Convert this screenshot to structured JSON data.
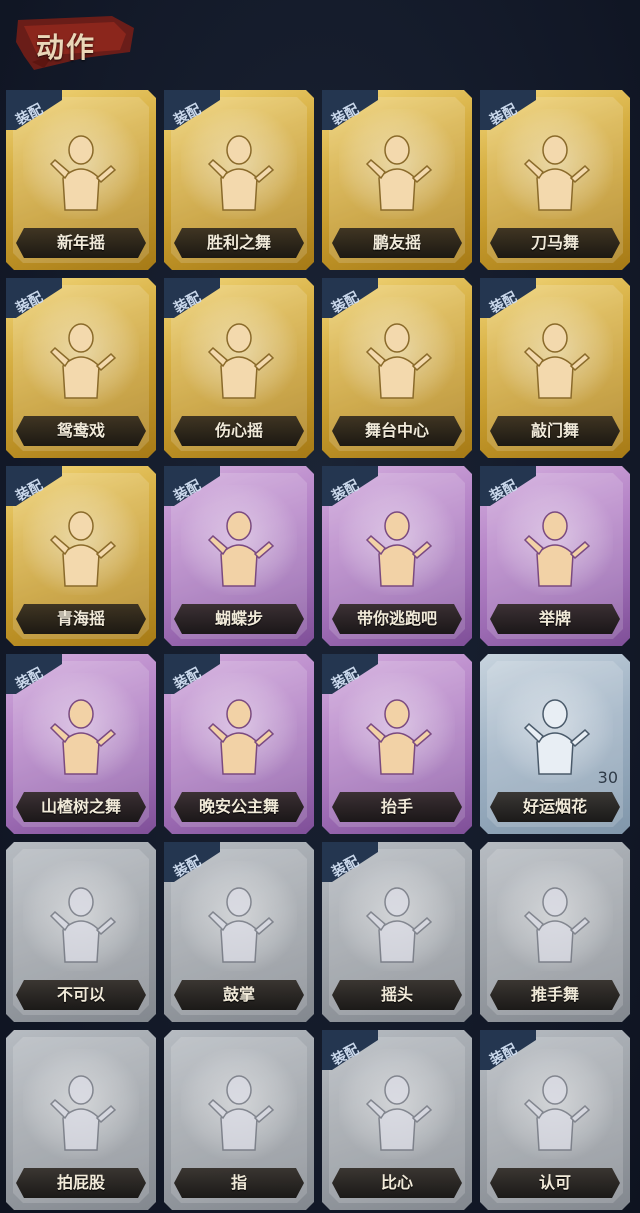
{
  "header": {
    "title": "动作"
  },
  "equip_label": "装配",
  "cards": [
    {
      "name": "新年摇",
      "tier": "gold",
      "equipped": true,
      "icon": "figure-wave-notes-icon"
    },
    {
      "name": "胜利之舞",
      "tier": "gold",
      "equipped": true,
      "icon": "figure-point-up-icon"
    },
    {
      "name": "鹏友摇",
      "tier": "gold",
      "equipped": true,
      "icon": "figure-point-side-icon"
    },
    {
      "name": "刀马舞",
      "tier": "gold",
      "equipped": true,
      "icon": "figure-arms-cross-icon"
    },
    {
      "name": "鸳鸯戏",
      "tier": "gold",
      "equipped": true,
      "icon": "figure-dance-notes-icon"
    },
    {
      "name": "伤心摇",
      "tier": "gold",
      "equipped": true,
      "icon": "figure-heart-hands-icon"
    },
    {
      "name": "舞台中心",
      "tier": "gold",
      "equipped": true,
      "icon": "figure-stage-center-icon"
    },
    {
      "name": "敲门舞",
      "tier": "gold",
      "equipped": true,
      "icon": "figure-knock-icon"
    },
    {
      "name": "青海摇",
      "tier": "gold",
      "equipped": true,
      "icon": "figure-shake-icon"
    },
    {
      "name": "蝴蝶步",
      "tier": "purple",
      "equipped": true,
      "icon": "figure-butterfly-icon"
    },
    {
      "name": "带你逃跑吧",
      "tier": "purple",
      "equipped": true,
      "icon": "figure-run-away-icon"
    },
    {
      "name": "举牌",
      "tier": "purple",
      "equipped": true,
      "icon": "figure-hold-sign-icon"
    },
    {
      "name": "山楂树之舞",
      "tier": "purple",
      "equipped": true,
      "icon": "figure-hawthorn-dance-icon"
    },
    {
      "name": "晚安公主舞",
      "tier": "purple",
      "equipped": true,
      "icon": "figure-goodnight-icon"
    },
    {
      "name": "抬手",
      "tier": "purple",
      "equipped": true,
      "icon": "figure-raise-hand-icon"
    },
    {
      "name": "好运烟花",
      "tier": "blue",
      "equipped": false,
      "icon": "firework-icon",
      "count": "30"
    },
    {
      "name": "不可以",
      "tier": "gray",
      "equipped": false,
      "icon": "finger-wag-icon"
    },
    {
      "name": "鼓掌",
      "tier": "gray",
      "equipped": true,
      "icon": "clap-icon"
    },
    {
      "name": "摇头",
      "tier": "gray",
      "equipped": true,
      "icon": "figure-head-shake-icon"
    },
    {
      "name": "推手舞",
      "tier": "gray",
      "equipped": false,
      "icon": "figure-push-hands-icon"
    },
    {
      "name": "拍屁股",
      "tier": "gray",
      "equipped": false,
      "icon": "figure-butt-pat-icon"
    },
    {
      "name": "指",
      "tier": "gray",
      "equipped": false,
      "icon": "point-hand-icon"
    },
    {
      "name": "比心",
      "tier": "gray",
      "equipped": true,
      "icon": "finger-heart-icon"
    },
    {
      "name": "认可",
      "tier": "gray",
      "equipped": true,
      "icon": "thumbs-up-icon"
    }
  ]
}
